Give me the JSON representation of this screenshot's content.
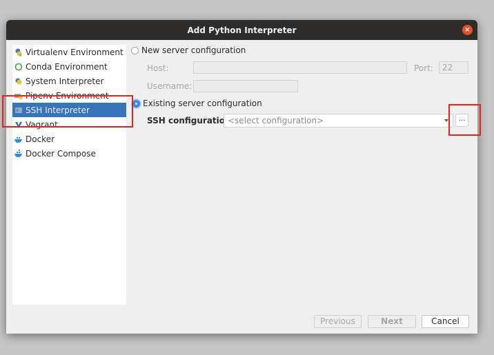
{
  "dialog": {
    "title": "Add Python Interpreter",
    "close_icon": "close-icon"
  },
  "sidebar": {
    "items": [
      {
        "label": "Virtualenv Environment",
        "icon": "virtualenv-icon",
        "selected": false
      },
      {
        "label": "Conda Environment",
        "icon": "conda-icon",
        "selected": false
      },
      {
        "label": "System Interpreter",
        "icon": "python-icon",
        "selected": false
      },
      {
        "label": "Pipenv Environment",
        "icon": "pipenv-icon",
        "selected": false
      },
      {
        "label": "SSH Interpreter",
        "icon": "terminal-icon",
        "selected": true
      },
      {
        "label": "Vagrant",
        "icon": "vagrant-icon",
        "selected": false
      },
      {
        "label": "Docker",
        "icon": "docker-icon",
        "selected": false
      },
      {
        "label": "Docker Compose",
        "icon": "docker-compose-icon",
        "selected": false
      }
    ]
  },
  "main": {
    "new_server": {
      "label": "New server configuration",
      "checked": false,
      "host_label": "Host:",
      "host_value": "",
      "port_label": "Port:",
      "port_value": "22",
      "username_label": "Username:",
      "username_value": ""
    },
    "existing_server": {
      "label": "Existing server configuration",
      "checked": true,
      "ssh_config_label": "SSH configuration:",
      "ssh_config_placeholder": "<select configuration>",
      "browse_label": "..."
    }
  },
  "footer": {
    "previous_label": "Previous",
    "next_label": "Next",
    "cancel_label": "Cancel"
  },
  "colors": {
    "selection": "#3874b8",
    "highlight_box": "#e8201a",
    "titlebar": "#2d2c2b",
    "close_button": "#e2512c"
  }
}
